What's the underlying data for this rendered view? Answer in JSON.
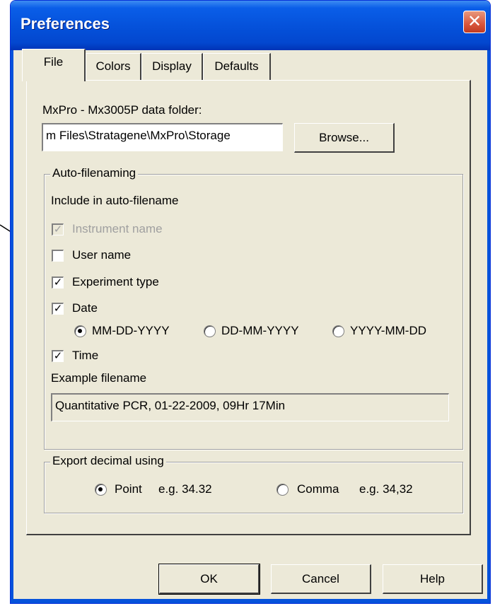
{
  "window": {
    "title": "Preferences"
  },
  "tabs": [
    {
      "label": "File",
      "active": true
    },
    {
      "label": "Colors",
      "active": false
    },
    {
      "label": "Display",
      "active": false
    },
    {
      "label": "Defaults",
      "active": false
    }
  ],
  "file_tab": {
    "data_folder_label": "MxPro - Mx3005P data folder:",
    "data_folder_value": "m Files\\Stratagene\\MxPro\\Storage",
    "browse_label": "Browse...",
    "autofilename": {
      "group_title": "Auto-filenaming",
      "include_label": "Include in auto-filename",
      "options": {
        "instrument_name": {
          "label": "Instrument name",
          "checked": true,
          "disabled": true
        },
        "user_name": {
          "label": "User name",
          "checked": false
        },
        "experiment_type": {
          "label": "Experiment type",
          "checked": true
        },
        "date": {
          "label": "Date",
          "checked": true
        },
        "time": {
          "label": "Time",
          "checked": true
        }
      },
      "date_formats": [
        {
          "label": "MM-DD-YYYY",
          "selected": true
        },
        {
          "label": "DD-MM-YYYY",
          "selected": false
        },
        {
          "label": "YYYY-MM-DD",
          "selected": false
        }
      ],
      "example_label": "Example filename",
      "example_value": "Quantitative PCR, 01-22-2009, 09Hr 17Min"
    },
    "export": {
      "group_title": "Export decimal using",
      "point_label": "Point",
      "point_example": "e.g. 34.32",
      "comma_label": "Comma",
      "comma_example": "e.g. 34,32",
      "selected": "point"
    }
  },
  "buttons": {
    "ok": "OK",
    "cancel": "Cancel",
    "help": "Help"
  },
  "icons": {
    "close": "close-icon",
    "check": "check-icon",
    "annotation": "annotation-arrow-icon"
  },
  "colors": {
    "titlebar": "#0552db",
    "face": "#ece9d8",
    "close": "#d8563c"
  }
}
